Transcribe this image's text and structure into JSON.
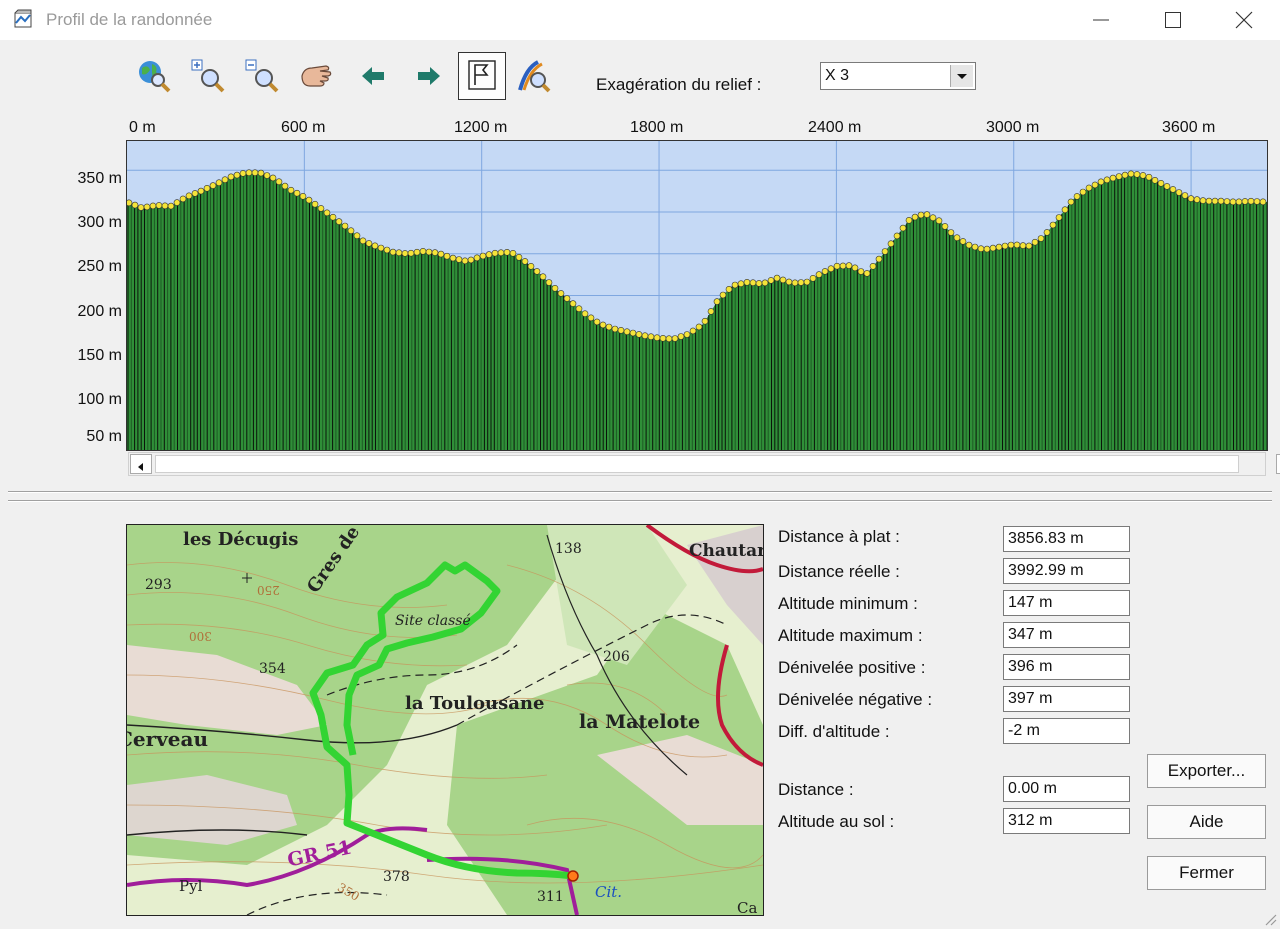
{
  "window": {
    "title": "Profil de la randonnée"
  },
  "toolbar": {
    "relief_label": "Exagération du relief :",
    "relief_value": "X 3",
    "icons": [
      "globe-search-icon",
      "zoom-in-icon",
      "zoom-out-icon",
      "hand-pan-icon",
      "arrow-left-icon",
      "arrow-right-icon",
      "flag-profile-icon",
      "route-search-icon"
    ]
  },
  "chart_data": {
    "type": "area",
    "xlabel": "",
    "ylabel": "",
    "x_tick_labels": [
      "0 m",
      "600 m",
      "1200 m",
      "1800 m",
      "2400 m",
      "3000 m",
      "3600 m"
    ],
    "y_tick_labels": [
      "350 m",
      "300 m",
      "250 m",
      "200 m",
      "150 m",
      "100 m",
      "50 m"
    ],
    "x_unit": "m",
    "y_unit": "m",
    "xlim": [
      0,
      3856.83
    ],
    "ylim": [
      15,
      385
    ],
    "grid": true,
    "colors": {
      "fill": "#2f8f38",
      "point": "#f5e43a",
      "sky": "#c5d9f5"
    },
    "x": [
      0,
      50,
      100,
      150,
      200,
      250,
      300,
      350,
      400,
      450,
      500,
      550,
      600,
      650,
      700,
      750,
      800,
      850,
      900,
      950,
      1000,
      1050,
      1100,
      1150,
      1200,
      1250,
      1300,
      1350,
      1400,
      1450,
      1500,
      1550,
      1600,
      1650,
      1700,
      1750,
      1800,
      1850,
      1900,
      1950,
      2000,
      2050,
      2100,
      2150,
      2200,
      2250,
      2300,
      2350,
      2400,
      2450,
      2500,
      2550,
      2600,
      2650,
      2700,
      2750,
      2800,
      2850,
      2900,
      2950,
      3000,
      3050,
      3100,
      3150,
      3200,
      3250,
      3300,
      3350,
      3400,
      3450,
      3500,
      3550,
      3600,
      3650,
      3700,
      3750,
      3800,
      3856
    ],
    "y": [
      312,
      305,
      308,
      307,
      318,
      325,
      333,
      342,
      347,
      347,
      340,
      327,
      318,
      306,
      293,
      280,
      265,
      258,
      252,
      250,
      253,
      251,
      245,
      241,
      247,
      251,
      252,
      240,
      225,
      208,
      193,
      178,
      166,
      160,
      156,
      152,
      149,
      148,
      154,
      166,
      195,
      212,
      216,
      214,
      221,
      215,
      216,
      227,
      235,
      236,
      225,
      246,
      269,
      292,
      298,
      289,
      271,
      260,
      255,
      258,
      261,
      259,
      270,
      292,
      315,
      328,
      337,
      342,
      346,
      343,
      334,
      325,
      316,
      313,
      313,
      312,
      313,
      312
    ]
  },
  "map": {
    "labels": [
      "les Décugis",
      "Gres de Ste-Anne",
      "Site classé",
      "138",
      "Chautard",
      "293",
      "354",
      "la Toulousane",
      "206",
      "la Matelote",
      "Cerveau",
      "GR 51",
      "378",
      "311",
      "Cit.",
      "Pyl",
      "Ca",
      "250",
      "300",
      "350"
    ]
  },
  "stats": [
    {
      "label": "Distance à plat :",
      "value": "3856.83 m"
    },
    {
      "label": "Distance réelle :",
      "value": "3992.99 m"
    },
    {
      "label": "Altitude minimum :",
      "value": "147 m"
    },
    {
      "label": "Altitude maximum :",
      "value": "347 m"
    },
    {
      "label": "Dénivelée positive :",
      "value": "396 m"
    },
    {
      "label": "Dénivelée négative :",
      "value": "397 m"
    },
    {
      "label": "Diff. d'altitude :",
      "value": "-2 m"
    }
  ],
  "cursor": [
    {
      "label": "Distance :",
      "value": "0.00 m"
    },
    {
      "label": "Altitude au sol :",
      "value": "312 m"
    }
  ],
  "buttons": {
    "export": "Exporter...",
    "help": "Aide",
    "close": "Fermer"
  }
}
